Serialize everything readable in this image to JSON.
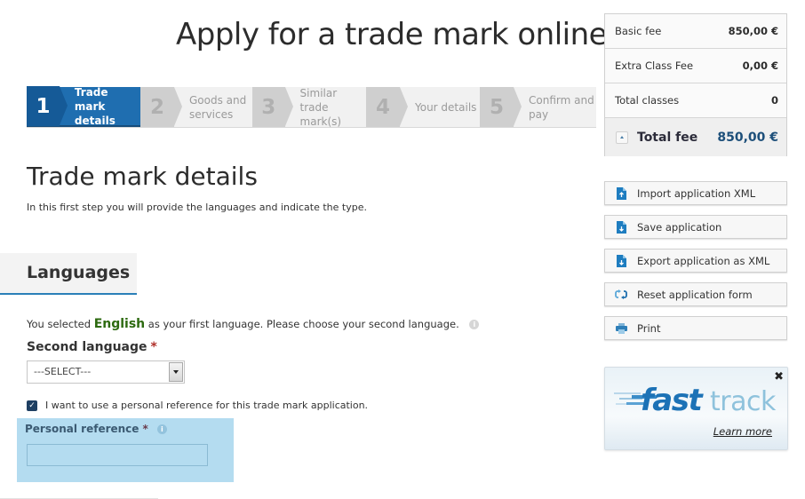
{
  "header": {
    "title": "Apply for a trade mark online"
  },
  "stepper": {
    "steps": [
      {
        "number": "1",
        "label_line1": "Trade mark",
        "label_line2": "details",
        "active": true
      },
      {
        "number": "2",
        "label_line1": "Goods and",
        "label_line2": "services",
        "active": false
      },
      {
        "number": "3",
        "label_line1": "Similar trade",
        "label_line2": "mark(s)",
        "active": false
      },
      {
        "number": "4",
        "label_line1": "Your details",
        "label_line2": "",
        "active": false
      },
      {
        "number": "5",
        "label_line1": "Confirm and",
        "label_line2": "pay",
        "active": false
      }
    ]
  },
  "main": {
    "section_title": "Trade mark details",
    "section_description": "In this first step you will provide the languages and indicate the type.",
    "languages_tab": "Languages",
    "language_info": {
      "prefix": "You selected ",
      "first_language": "English",
      "suffix": " as your first language. Please choose your second language.",
      "info_icon": "info-icon"
    },
    "second_language": {
      "label": "Second language",
      "required_mark": "*",
      "selected_value": "---SELECT---"
    },
    "personal_reference_checkbox": {
      "checked": true,
      "label": "I want to use a personal reference for this trade mark application."
    },
    "personal_reference": {
      "label": "Personal reference",
      "required_mark": "*",
      "value": "",
      "placeholder": ""
    }
  },
  "fees": {
    "rows": [
      {
        "label": "Basic fee",
        "value": "850,00 €"
      },
      {
        "label": "Extra Class Fee",
        "value": "0,00 €"
      },
      {
        "label": "Total classes",
        "value": "0"
      }
    ],
    "total": {
      "label": "Total fee",
      "value": "850,00 €"
    }
  },
  "actions": [
    {
      "label": "Import application XML",
      "icon": "import-file-icon"
    },
    {
      "label": "Save application",
      "icon": "save-file-icon"
    },
    {
      "label": "Export application as XML",
      "icon": "export-file-icon"
    },
    {
      "label": "Reset application form",
      "icon": "reset-icon"
    },
    {
      "label": "Print",
      "icon": "print-icon"
    }
  ],
  "fasttrack": {
    "logo_word1": "fast",
    "logo_word2": "track",
    "learn_more": "Learn more",
    "close_icon": "close-icon"
  },
  "colors": {
    "active_step": "#1f6eb0",
    "active_step_number": "#155a97",
    "english_highlight": "#2d6a10",
    "required": "#b0302a",
    "reference_panel": "#b4dcf0",
    "total_fee_value": "#1d4f7a",
    "tab_underline": "#2a7fb8"
  }
}
